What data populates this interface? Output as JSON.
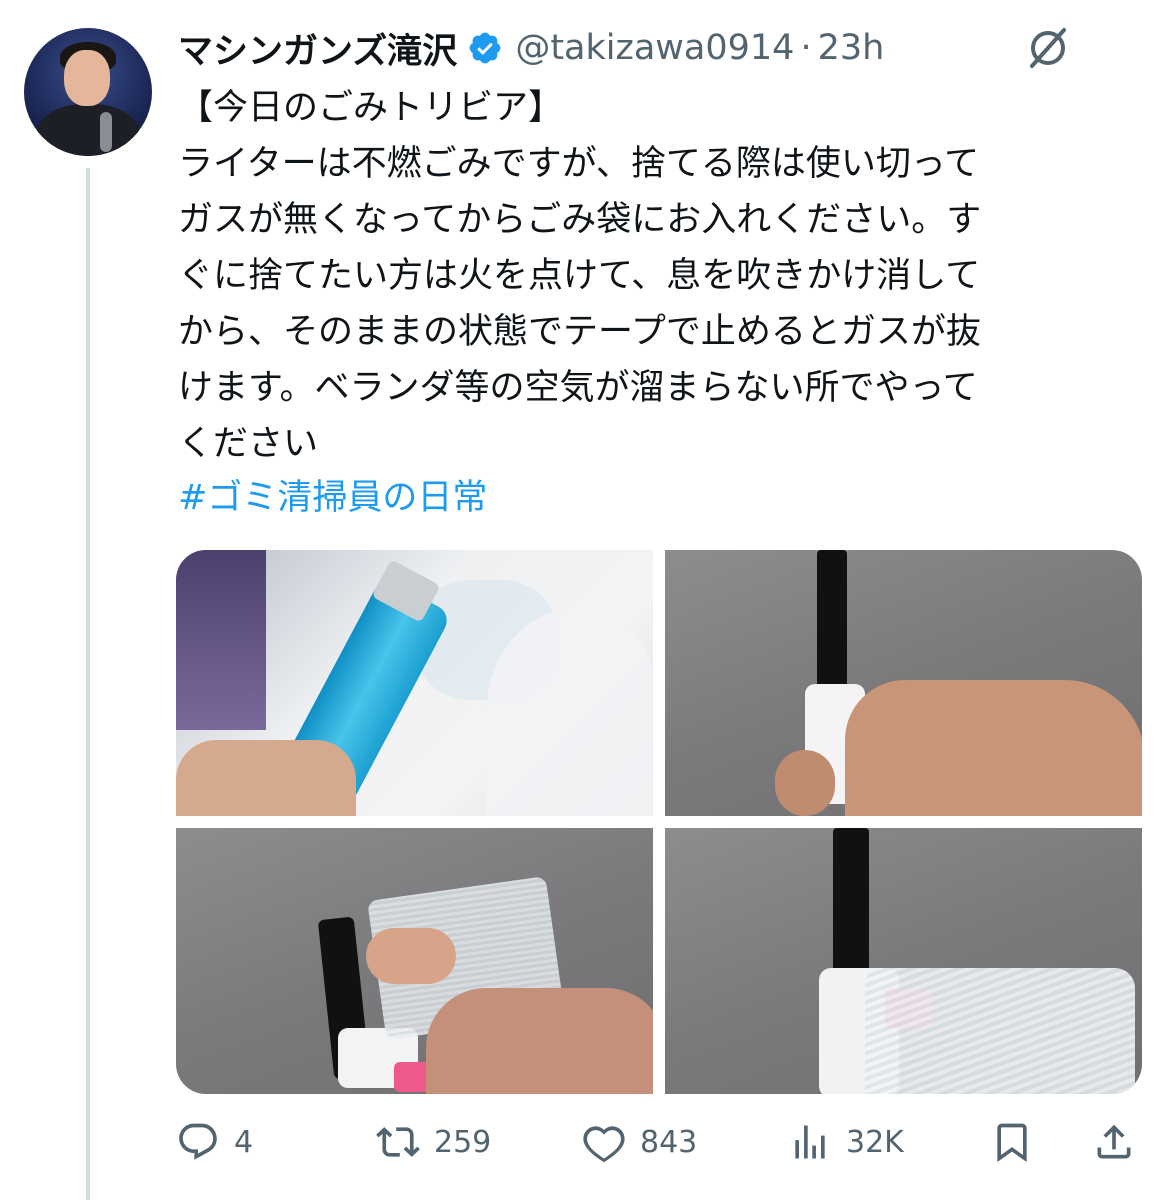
{
  "user": {
    "display_name": "マシンガンズ滝沢",
    "handle": "@takizawa0914",
    "separator": "·",
    "time": "23h"
  },
  "tweet": {
    "text": "【今日のごみトリビア】\nライターは不燃ごみですが、捨てる際は使い切って\nガスが無くなってからごみ袋にお入れください。す\nぐに捨てたい方は火を点けて、息を吹きかけ消して\nから、そのままの状態でテープで止めるとガスが抜\nけます。ベランダ等の空気が溜まらない所でやって\nください",
    "hashtag": "#ゴミ清掃員の日常"
  },
  "media": {
    "count": 4
  },
  "actions": {
    "replies": "4",
    "reposts": "259",
    "likes": "843",
    "views": "32K"
  },
  "colors": {
    "accent": "#1d9bf0",
    "text": "#0f1419",
    "muted": "#536471",
    "thread_line": "#cfd9de"
  },
  "icons": [
    "verified-badge-icon",
    "grok-icon",
    "reply-icon",
    "repost-icon",
    "like-icon",
    "views-icon",
    "bookmark-icon",
    "share-icon"
  ]
}
